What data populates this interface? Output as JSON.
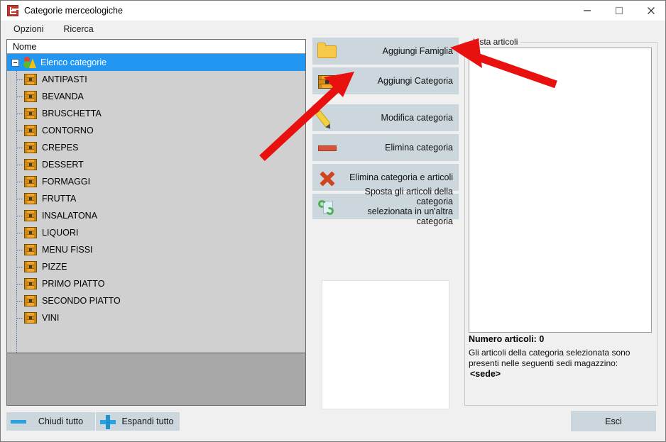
{
  "window": {
    "title": "Categorie merceologiche",
    "app_icon": "app-icon",
    "controls": {
      "minimize": "minimize-icon",
      "maximize": "maximize-icon",
      "close": "close-icon"
    }
  },
  "menubar": {
    "items": [
      {
        "label": "Opzioni"
      },
      {
        "label": "Ricerca"
      }
    ]
  },
  "tree": {
    "column_header": "Nome",
    "root": {
      "label": "Elenco categorie",
      "icon": "shapes-icon",
      "expanded": true,
      "selected": true
    },
    "children": [
      {
        "label": "ANTIPASTI",
        "icon": "chest-icon"
      },
      {
        "label": "BEVANDA",
        "icon": "chest-icon"
      },
      {
        "label": "BRUSCHETTA",
        "icon": "chest-icon"
      },
      {
        "label": "CONTORNO",
        "icon": "chest-icon"
      },
      {
        "label": "CREPES",
        "icon": "chest-icon"
      },
      {
        "label": "DESSERT",
        "icon": "chest-icon"
      },
      {
        "label": "FORMAGGI",
        "icon": "chest-icon"
      },
      {
        "label": "FRUTTA",
        "icon": "chest-icon"
      },
      {
        "label": "INSALATONA",
        "icon": "chest-icon"
      },
      {
        "label": "LIQUORI",
        "icon": "chest-icon"
      },
      {
        "label": "MENU FISSI",
        "icon": "chest-icon"
      },
      {
        "label": "PIZZE",
        "icon": "chest-icon"
      },
      {
        "label": "PRIMO PIATTO",
        "icon": "chest-icon"
      },
      {
        "label": "SECONDO PIATTO",
        "icon": "chest-icon"
      },
      {
        "label": "VINI",
        "icon": "chest-icon"
      }
    ]
  },
  "actions": [
    {
      "label": "Aggiungi Famiglia",
      "icon": "folder-icon"
    },
    {
      "label": "Aggiungi Categoria",
      "icon": "chest-icon"
    },
    {
      "label": "Modifica categoria",
      "icon": "pencil-icon"
    },
    {
      "label": "Elimina categoria",
      "icon": "red-bar-icon"
    },
    {
      "label": "Elimina categoria e articoli",
      "icon": "red-x-icon"
    },
    {
      "label": "Sposta gli articoli della categoria selezionata in un'altra categoria",
      "line1": "Sposta gli articoli della categoria",
      "line2": "selezionata in un'altra categoria",
      "icon": "sync-icon"
    }
  ],
  "right_panel": {
    "legend": "Lista articoli",
    "item_count_label": "Numero articoli: 0",
    "description": "Gli articoli della categoria selezionata sono presenti nelle seguenti sedi magazzino:",
    "sede": "<sede>"
  },
  "bottom": {
    "collapse_all": "Chiudi tutto",
    "expand_all": "Espandi tutto",
    "exit": "Esci"
  },
  "colors": {
    "selection_blue": "#2196f3",
    "button_face": "#ccd6dd",
    "window_bg": "#f0f0f0",
    "tree_bg": "#d0d0d0",
    "tree_filler": "#a8a8a8",
    "annotation_red": "#e8110f",
    "accent_icon_orange": "#f5a623"
  },
  "annotations": [
    {
      "name": "arrow-to-aggiungi-categoria",
      "color": "#e8110f"
    },
    {
      "name": "arrow-to-aggiungi-famiglia",
      "color": "#e8110f"
    }
  ]
}
